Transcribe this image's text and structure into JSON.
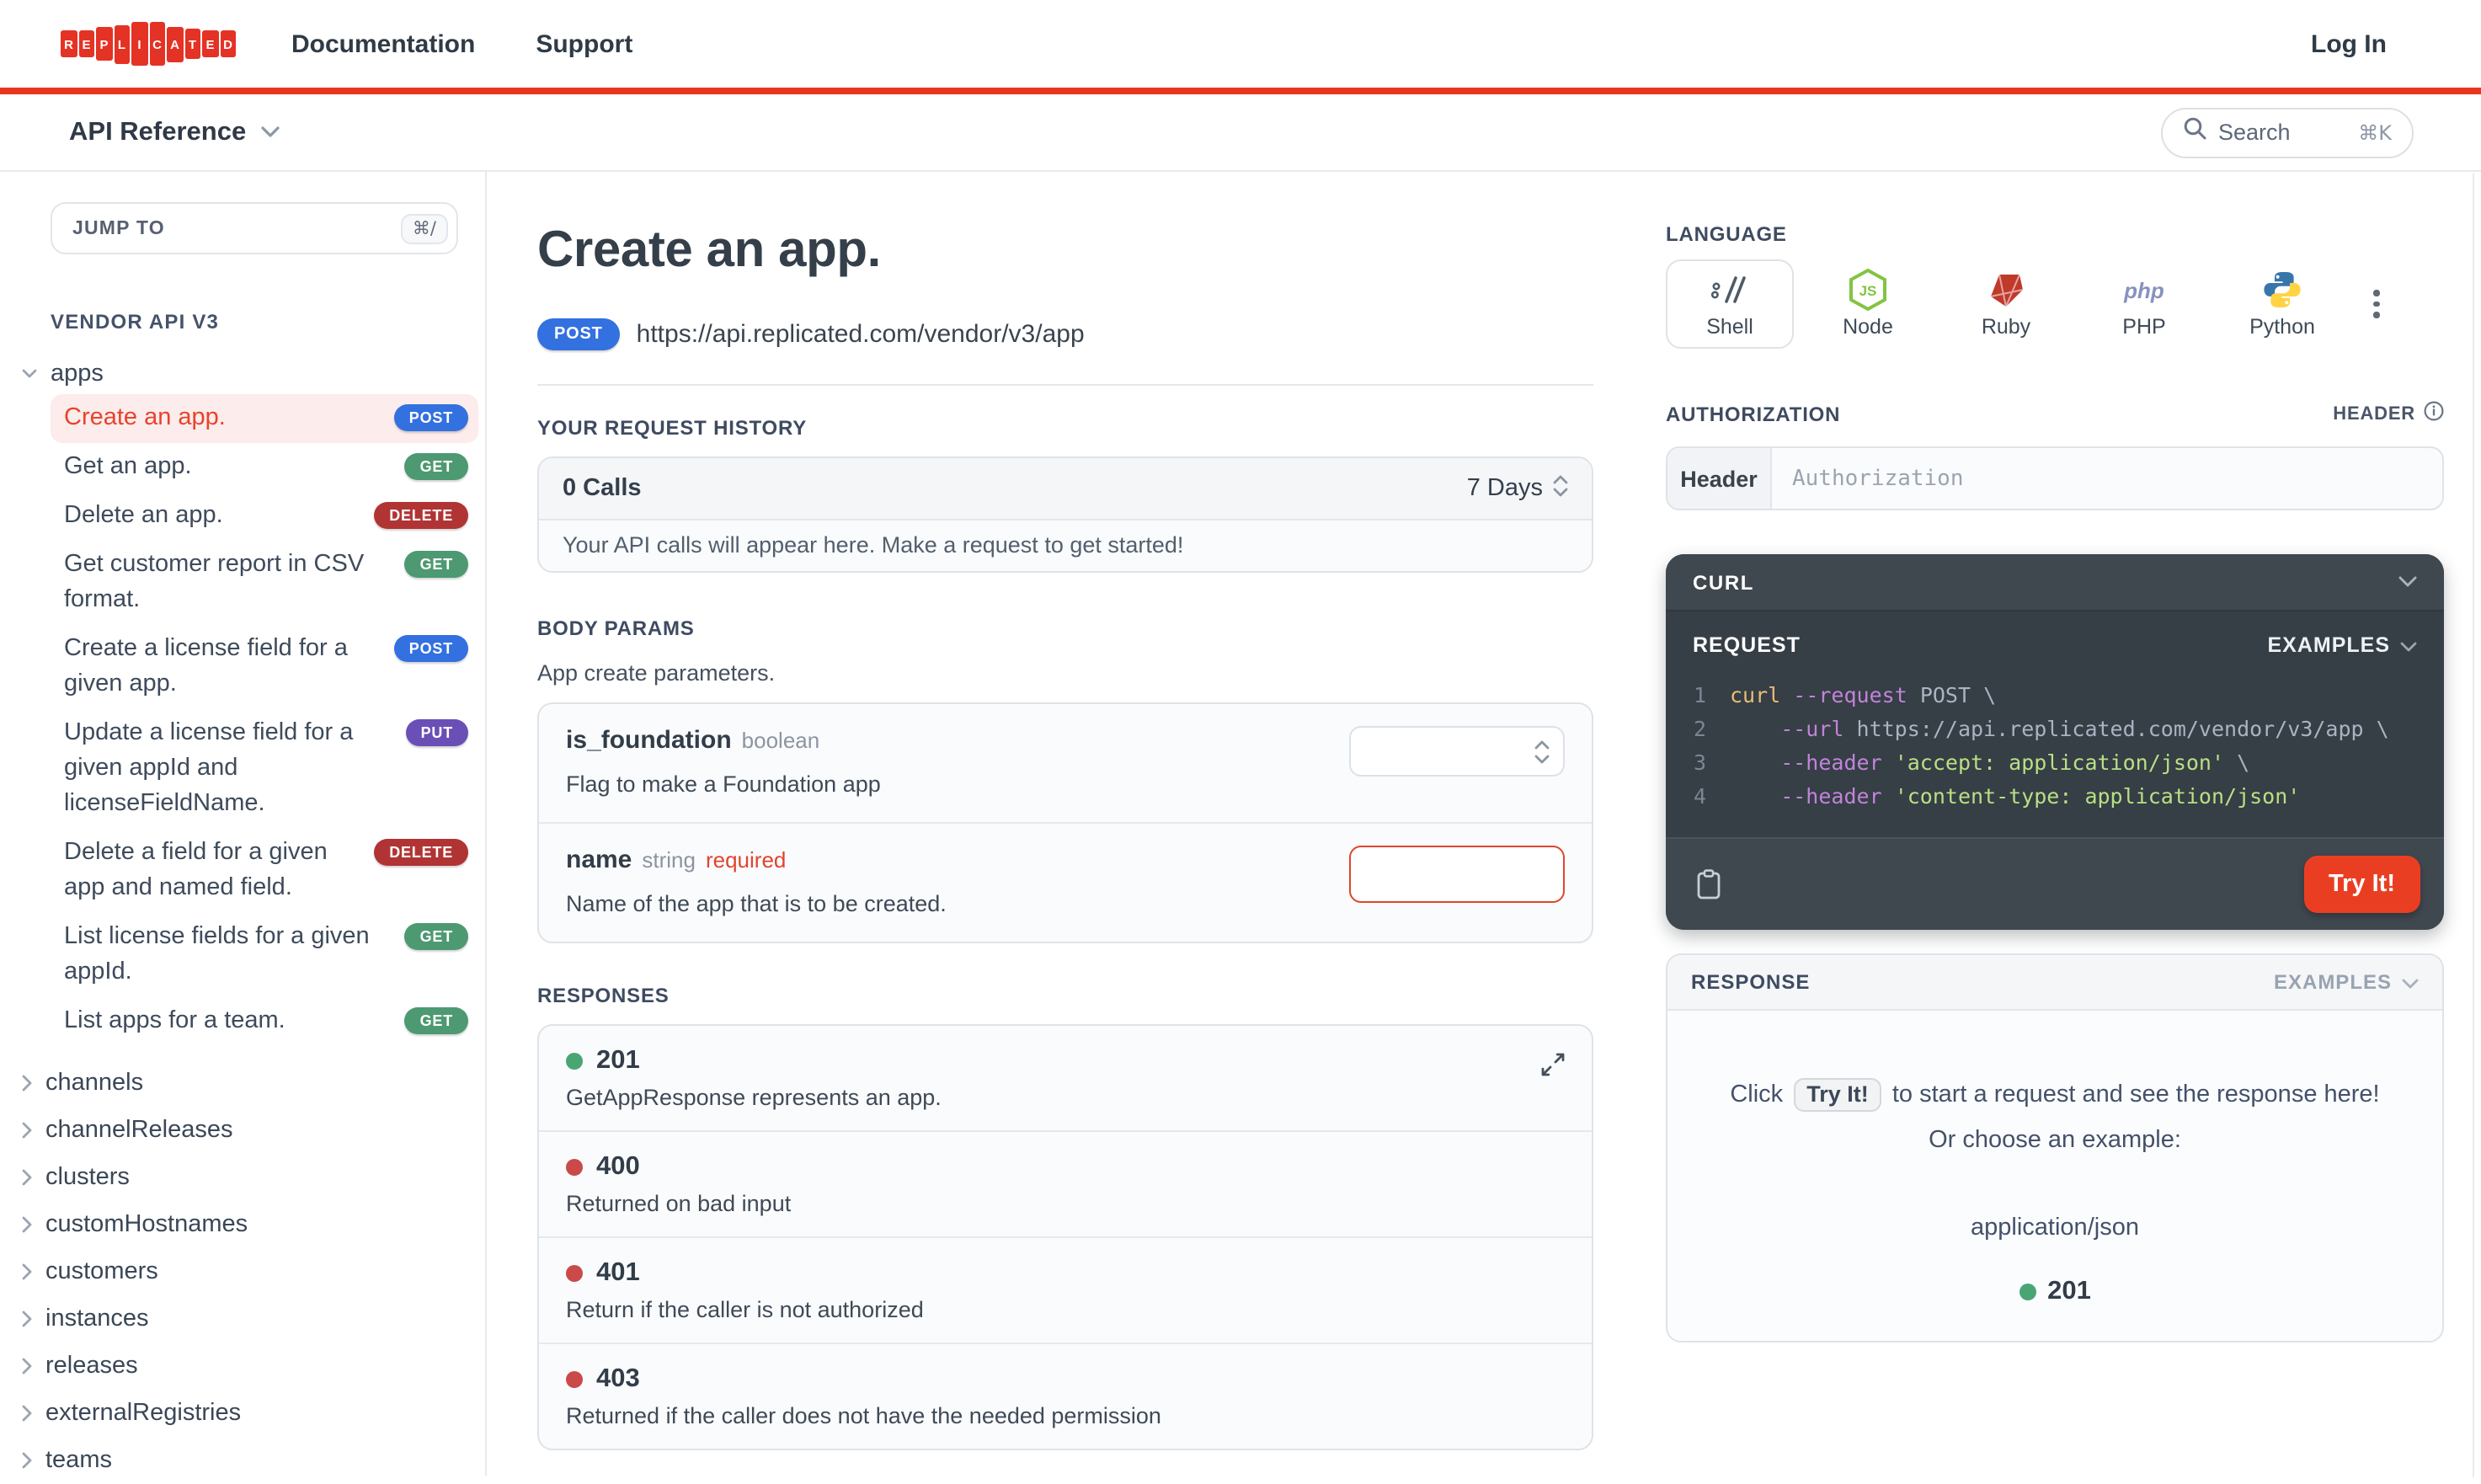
{
  "topnav": {
    "brand": "REPLICATED",
    "links": [
      {
        "label": "Documentation"
      },
      {
        "label": "Support"
      }
    ],
    "login_label": "Log In"
  },
  "subnav": {
    "project": "API Reference",
    "search_placeholder": "Search",
    "search_shortcut": "⌘K"
  },
  "sidebar": {
    "jump_to_placeholder": "JUMP TO",
    "jump_to_shortcut": "⌘/",
    "section_title": "VENDOR API V3",
    "group": "apps",
    "endpoints": [
      {
        "label": "Create an app.",
        "method": "POST",
        "active": true
      },
      {
        "label": "Get an app.",
        "method": "GET",
        "active": false
      },
      {
        "label": "Delete an app.",
        "method": "DELETE",
        "active": false
      },
      {
        "label": "Get customer report in CSV format.",
        "method": "GET",
        "active": false
      },
      {
        "label": "Create a license field for a given app.",
        "method": "POST",
        "active": false
      },
      {
        "label": "Update a license field for a given appId and licenseFieldName.",
        "method": "PUT",
        "active": false
      },
      {
        "label": "Delete a field for a given app and named field.",
        "method": "DELETE",
        "active": false
      },
      {
        "label": "List license fields for a given appId.",
        "method": "GET",
        "active": false
      },
      {
        "label": "List apps for a team.",
        "method": "GET",
        "active": false
      }
    ],
    "groups": [
      "channels",
      "channelReleases",
      "clusters",
      "customHostnames",
      "customers",
      "instances",
      "releases",
      "externalRegistries",
      "teams"
    ]
  },
  "main": {
    "title": "Create an app.",
    "method": "POST",
    "url": "https://api.replicated.com/vendor/v3/app",
    "history": {
      "heading": "YOUR REQUEST HISTORY",
      "calls": "0 Calls",
      "range": "7 Days",
      "empty": "Your API calls will appear here. Make a request to get started!"
    },
    "body_params": {
      "heading": "BODY PARAMS",
      "description": "App create parameters.",
      "params": [
        {
          "name": "is_foundation",
          "type": "boolean",
          "required": "",
          "description": "Flag to make a Foundation app",
          "control": "select"
        },
        {
          "name": "name",
          "type": "string",
          "required": "required",
          "description": "Name of the app that is to be created.",
          "control": "input"
        }
      ]
    },
    "responses": {
      "heading": "RESPONSES",
      "items": [
        {
          "code": "201",
          "status": "success",
          "description": "GetAppResponse represents an app."
        },
        {
          "code": "400",
          "status": "error",
          "description": "Returned on bad input"
        },
        {
          "code": "401",
          "status": "error",
          "description": "Return if the caller is not authorized"
        },
        {
          "code": "403",
          "status": "error",
          "description": "Returned if the caller does not have the needed permission"
        }
      ]
    }
  },
  "right": {
    "language": {
      "heading": "LANGUAGE",
      "options": [
        "Shell",
        "Node",
        "Ruby",
        "PHP",
        "Python"
      ],
      "selected": "Shell"
    },
    "auth": {
      "heading": "AUTHORIZATION",
      "badge": "HEADER",
      "row_label": "Header",
      "placeholder": "Authorization"
    },
    "curl": {
      "title": "CURL",
      "request_label": "REQUEST",
      "examples_label": "EXAMPLES",
      "code_lines": [
        {
          "num": "1",
          "segments": [
            [
              "cmd",
              "curl "
            ],
            [
              "flag",
              "--request "
            ],
            [
              "plain",
              "POST \\"
            ]
          ]
        },
        {
          "num": "2",
          "segments": [
            [
              "flag",
              "    --url "
            ],
            [
              "plain",
              "https://api.replicated.com/vendor/v3/app \\"
            ]
          ]
        },
        {
          "num": "3",
          "segments": [
            [
              "flag",
              "    --header "
            ],
            [
              "str",
              "'accept: application/json'"
            ],
            [
              "plain",
              " \\"
            ]
          ]
        },
        {
          "num": "4",
          "segments": [
            [
              "flag",
              "    --header "
            ],
            [
              "str",
              "'content-type: application/json'"
            ]
          ]
        }
      ],
      "try_label": "Try It!"
    },
    "response": {
      "title": "RESPONSE",
      "examples_label": "EXAMPLES",
      "click_prefix": "Click",
      "try_label": "Try It!",
      "click_suffix": "to start a request and see the response here!",
      "or_line": "Or choose an example:",
      "example_type": "application/json",
      "example_code": "201"
    }
  },
  "colors": {
    "brand_red": "#e8371f",
    "method_post": "#3370e0",
    "method_get": "#4d9972",
    "method_delete": "#b13434",
    "method_put": "#6a4fb6",
    "status_success": "#4aa575",
    "status_error": "#ca4a4a",
    "try_button": "#ea3e23",
    "active_link": "#e8432d"
  }
}
